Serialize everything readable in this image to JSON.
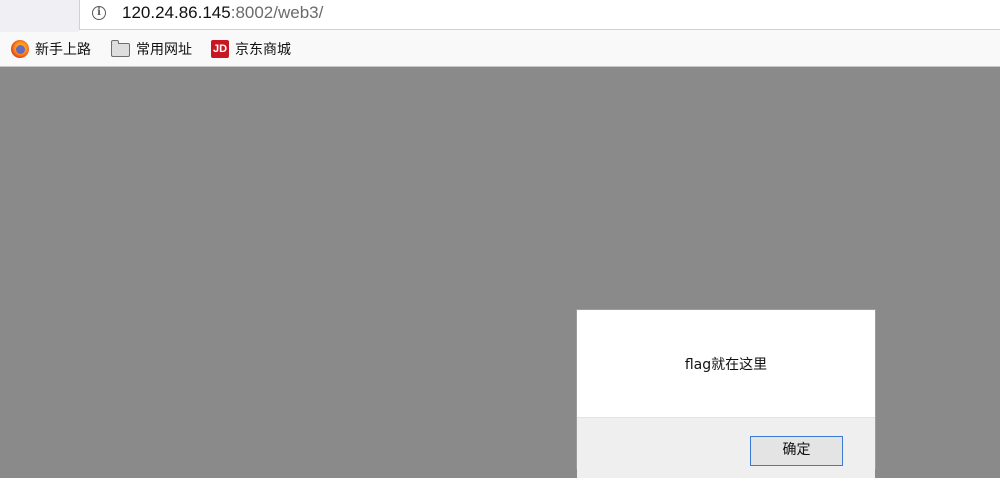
{
  "browser": {
    "url_host": "120.24.86.145",
    "url_rest": ":8002/web3/",
    "info_icon": "info-icon",
    "bookmarks": [
      {
        "label": "新手上路",
        "icon": "firefox-icon"
      },
      {
        "label": "常用网址",
        "icon": "folder-icon"
      },
      {
        "label": "京东商城",
        "icon": "jd-icon",
        "icon_text": "JD"
      }
    ]
  },
  "dialog": {
    "message": "flag就在这里",
    "ok_label": "确定"
  },
  "colors": {
    "page_overlay": "#8a8a8a",
    "button_focus_border": "#3a7bd5",
    "jd_red": "#c81623"
  }
}
